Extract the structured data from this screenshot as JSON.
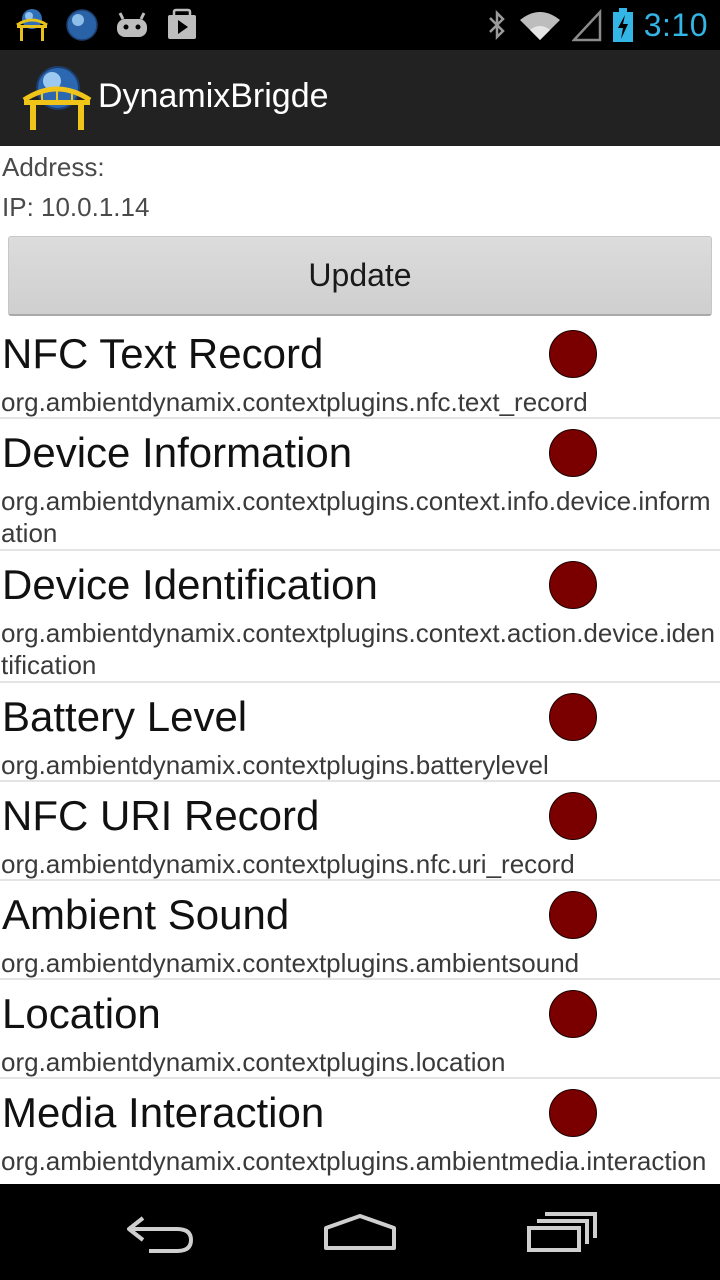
{
  "status_bar": {
    "time": "3:10",
    "notification_icons": [
      "bridge-icon",
      "globe-icon",
      "android-icon",
      "play-store-icon"
    ],
    "system_icons": [
      "bluetooth-icon",
      "wifi-icon",
      "signal-icon",
      "battery-charging-icon"
    ]
  },
  "app": {
    "title": "DynamixBrigde",
    "icon": "bridge-globe-icon"
  },
  "info": {
    "address_label": "Address:",
    "ip_line": "IP: 10.0.1.14"
  },
  "update_button": {
    "label": "Update"
  },
  "plugins": [
    {
      "name": "NFC Text Record",
      "id": "org.ambientdynamix.contextplugins.nfc.text_record",
      "status_color": "#7a0000"
    },
    {
      "name": "Device Information",
      "id": "org.ambientdynamix.contextplugins.context.info.device.information",
      "status_color": "#7a0000"
    },
    {
      "name": "Device Identification",
      "id": "org.ambientdynamix.contextplugins.context.action.device.identification",
      "status_color": "#7a0000"
    },
    {
      "name": "Battery Level",
      "id": "org.ambientdynamix.contextplugins.batterylevel",
      "status_color": "#7a0000"
    },
    {
      "name": "NFC URI Record",
      "id": "org.ambientdynamix.contextplugins.nfc.uri_record",
      "status_color": "#7a0000"
    },
    {
      "name": "Ambient Sound",
      "id": "org.ambientdynamix.contextplugins.ambientsound",
      "status_color": "#7a0000"
    },
    {
      "name": "Location",
      "id": "org.ambientdynamix.contextplugins.location",
      "status_color": "#7a0000"
    },
    {
      "name": "Media Interaction",
      "id": "org.ambientdynamix.contextplugins.ambientmedia.interaction",
      "status_color": "#7a0000"
    }
  ],
  "nav_bar": {
    "buttons": [
      "back-icon",
      "home-icon",
      "recent-apps-icon"
    ]
  },
  "colors": {
    "status_accent": "#33b5e5",
    "action_bar": "#222222",
    "status_dot": "#7a0000"
  }
}
